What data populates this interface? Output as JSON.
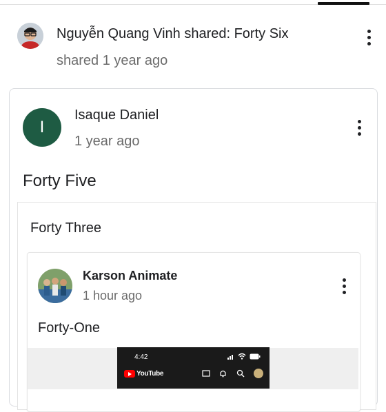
{
  "shared_post": {
    "title": "Nguyễn Quang Vinh shared: Forty Six",
    "meta": "shared 1 year ago",
    "avatar": "user-photo-avatar"
  },
  "post": {
    "author": "Isaque Daniel",
    "avatar_initial": "I",
    "time": "1 year ago",
    "body": "Forty Five",
    "avatar_color": "#1e5b43"
  },
  "inner_post": {
    "body": "Forty Three"
  },
  "nested_post": {
    "author": "Karson Animate",
    "time": "1 hour ago",
    "body": "Forty-One",
    "avatar": "group-photo-avatar"
  },
  "media": {
    "status_time": "4:42",
    "app_name": "YouTube",
    "icons": [
      "signal-icon",
      "wifi-icon",
      "battery-icon",
      "cast-icon",
      "bell-icon",
      "search-icon",
      "account-icon"
    ]
  }
}
